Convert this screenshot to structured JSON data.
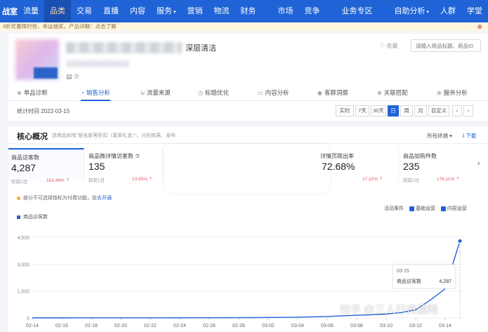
{
  "topnav": {
    "brand": "战室",
    "items": [
      "流量",
      "品类",
      "交易",
      "直播",
      "内容",
      "服务",
      "营销",
      "物流",
      "财务",
      "市场",
      "竞争",
      "业务专区",
      "自助分析",
      "人群",
      "学堂"
    ],
    "active_index": 1,
    "caret_items": [
      5,
      12
    ]
  },
  "notice": {
    "text": "9折优惠限时抢，幸运抽奖，产品详解：点击了解",
    "close": "⊗"
  },
  "product": {
    "title_suffix": "深层清洁",
    "favorite": "收藏",
    "search_placeholder": "请输入商品标题、商品ID"
  },
  "tabs": [
    "单品诊断",
    "销售分析",
    "流量来源",
    "标题优化",
    "内容分析",
    "客群洞察",
    "关联搭配",
    "服务分析"
  ],
  "tab_icons": [
    "⊕",
    "◔",
    "⇲",
    "◷",
    "▭",
    "◉",
    "⊗",
    "⊕"
  ],
  "active_tab": 1,
  "datebar": {
    "stat_time": "统计时间 2022-03-15",
    "ranges": [
      "实时",
      "7天",
      "30天",
      "日",
      "周",
      "月",
      "自定义"
    ],
    "active_range": 3,
    "prev": "‹",
    "next": "›"
  },
  "core": {
    "title": "核心概况",
    "desc": "该商品如有“报名新客折扣（嘉单礼金）”，分别效果、发布",
    "all_channels": "所有终端",
    "download": "下载",
    "hint": "部分不可选择指标为付费功能，前",
    "hint_link": "去开通",
    "event_label": "活动事件",
    "event_items": [
      "基础运营",
      "内容运营"
    ],
    "legend": "商品访客数"
  },
  "cards": [
    {
      "label": "商品访客数",
      "value": "4,287",
      "compare": "较前1日",
      "pct": "163.49%",
      "arrow": "⇡"
    },
    {
      "label": "商品微详情访客数 ⑦",
      "value": "135",
      "compare": "较前1日",
      "pct": "23.85%",
      "arrow": "⇡"
    },
    {
      "label": "详情页跳出率",
      "value": "72.68%",
      "compare": "",
      "pct": "17.32%",
      "arrow": "⇡"
    },
    {
      "label": "商品加购件数",
      "value": "235",
      "compare": "较前1日",
      "pct": "178.11%",
      "arrow": "⇡"
    }
  ],
  "card_next": "›",
  "chart_data": {
    "type": "line",
    "categories": [
      "02-14",
      "02-15",
      "02-16",
      "02-17",
      "02-18",
      "02-19",
      "02-20",
      "02-21",
      "02-22",
      "02-23",
      "02-24",
      "02-25",
      "02-26",
      "02-27",
      "02-28",
      "03-01",
      "03-02",
      "03-03",
      "03-04",
      "03-05",
      "03-06",
      "03-07",
      "03-08",
      "03-09",
      "03-10",
      "03-11",
      "03-12",
      "03-13",
      "03-14",
      "03-15"
    ],
    "tick_labels": [
      "02-14",
      "02-16",
      "02-18",
      "02-20",
      "02-22",
      "02-24",
      "02-26",
      "02-28",
      "03-02",
      "03-04",
      "03-06",
      "03-08",
      "03-10",
      "03-12",
      "03-14"
    ],
    "series": [
      {
        "name": "商品访客数",
        "values": [
          5,
          5,
          5,
          6,
          6,
          6,
          7,
          8,
          9,
          9,
          10,
          12,
          14,
          15,
          18,
          20,
          25,
          30,
          40,
          60,
          80,
          120,
          150,
          180,
          220,
          300,
          450,
          1000,
          1627,
          4287
        ]
      }
    ],
    "y_ticks": [
      "0",
      "1,500",
      "3,000",
      "4,500"
    ],
    "ylim": [
      0,
      5200
    ],
    "tooltip": {
      "date": "03-15",
      "label": "商品访客数",
      "value": "4,287"
    },
    "color": "#1f63d6"
  },
  "watermark": "知乎 @三人行资源网"
}
